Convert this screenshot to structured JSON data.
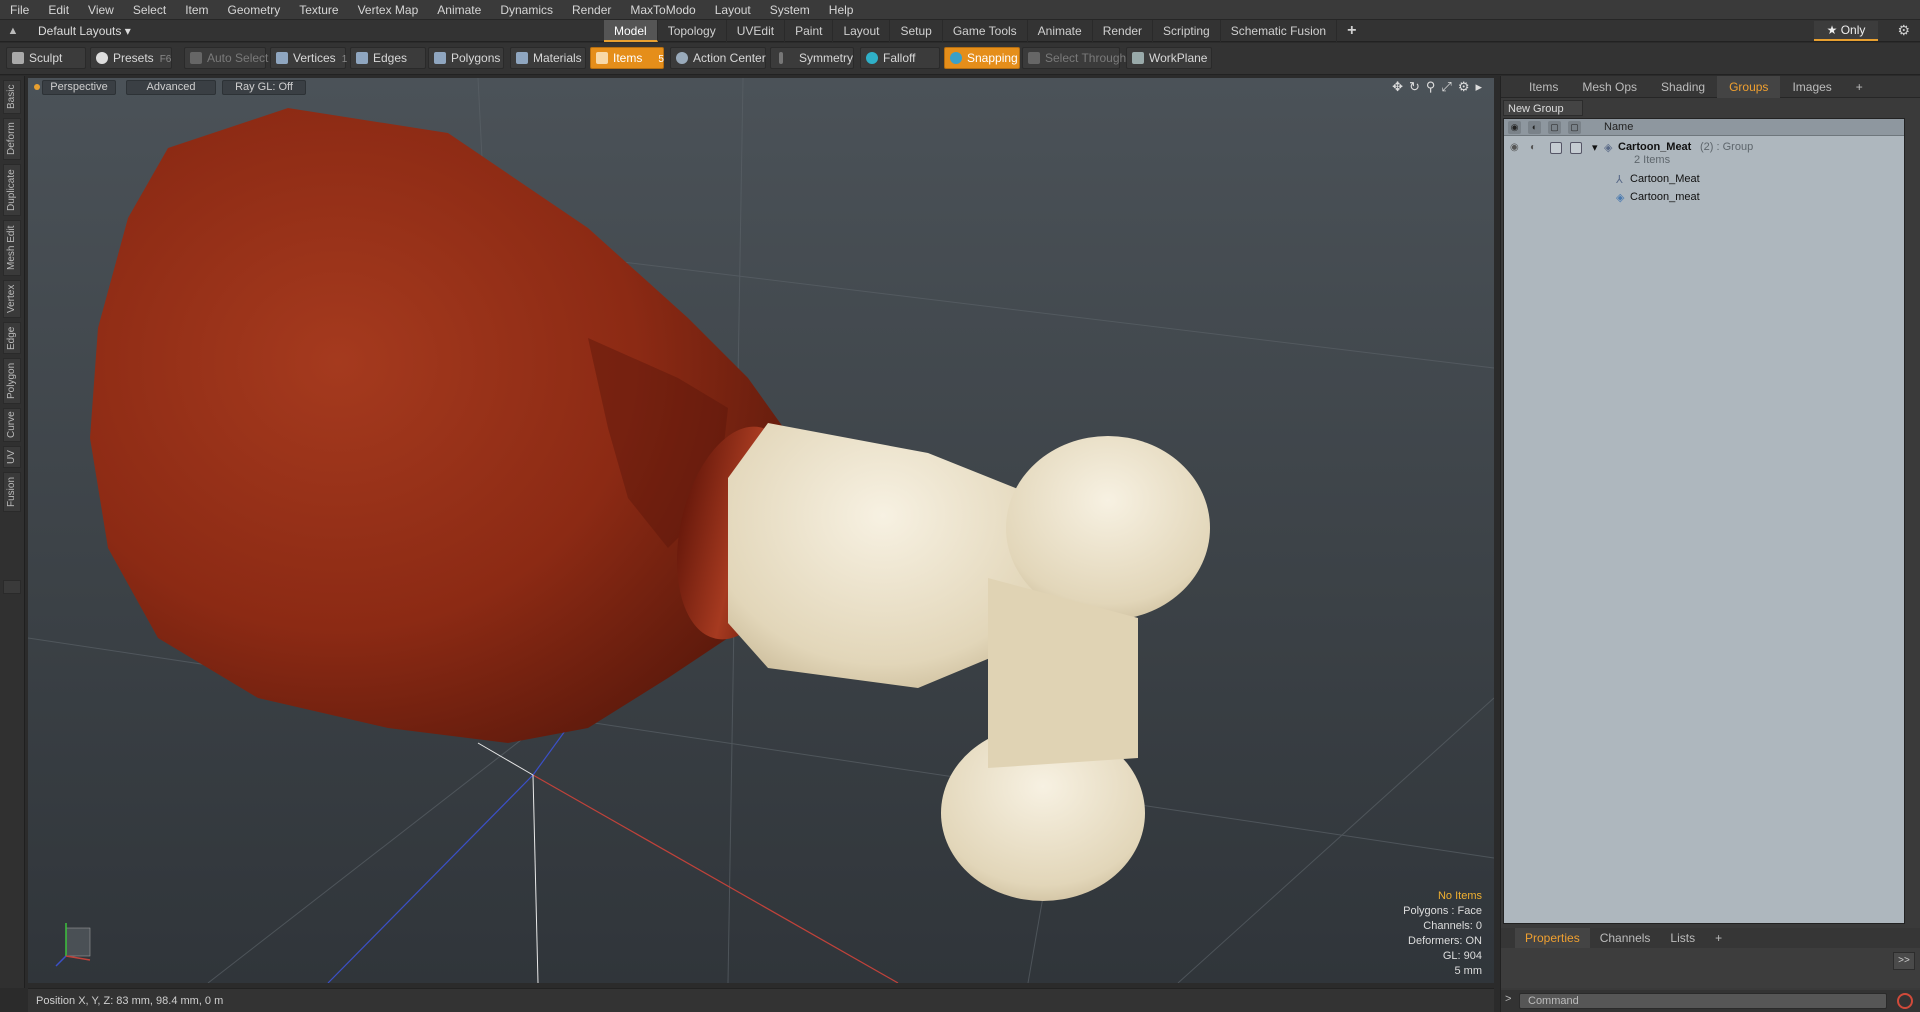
{
  "menubar": [
    "File",
    "Edit",
    "View",
    "Select",
    "Item",
    "Geometry",
    "Texture",
    "Vertex Map",
    "Animate",
    "Dynamics",
    "Render",
    "MaxToModo",
    "Layout",
    "System",
    "Help"
  ],
  "layout_dropdown": "Default Layouts ▾",
  "mode_tabs": [
    "Model",
    "Topology",
    "UVEdit",
    "Paint",
    "Layout",
    "Setup",
    "Game Tools",
    "Animate",
    "Render",
    "Scripting",
    "Schematic Fusion",
    "+"
  ],
  "active_mode_tab": "Model",
  "only_label": "★  Only",
  "toolbar": {
    "sculpt": "Sculpt",
    "presets": "Presets",
    "presets_key": "F6",
    "auto_select": "Auto Select",
    "vertices": "Vertices",
    "vertices_key": "1",
    "edges": "Edges",
    "edges_key": "2",
    "polygons": "Polygons",
    "materials": "Materials",
    "items": "Items",
    "items_key": "5",
    "action_center": "Action Center",
    "symmetry": "Symmetry",
    "falloff": "Falloff",
    "snapping": "Snapping",
    "select_through": "Select Through",
    "workplane": "WorkPlane"
  },
  "left_tabs": [
    "Basic",
    "Deform",
    "Duplicate",
    "Mesh Edit",
    "Vertex",
    "Edge",
    "Polygon",
    "Curve",
    "UV",
    "Fusion"
  ],
  "viewport": {
    "view": "Perspective",
    "shading": "Advanced",
    "raygl": "Ray GL: Off",
    "info": {
      "no_items": "No Items",
      "polygons": "Polygons : Face",
      "channels": "Channels: 0",
      "deformers": "Deformers: ON",
      "gl": "GL: 904",
      "scale": "5 mm"
    }
  },
  "status": "Position X, Y, Z:  83 mm, 98.4 mm, 0 m",
  "right_panel": {
    "tabs": [
      "Items",
      "Mesh Ops",
      "Shading",
      "Groups",
      "Images",
      "+"
    ],
    "active_tab": "Groups",
    "new_group": "New Group",
    "column_name": "Name",
    "group": {
      "name": "Cartoon_Meat",
      "suffix": "(2) : Group",
      "count": "2 Items"
    },
    "children": [
      "Cartoon_Meat",
      "Cartoon_meat"
    ],
    "bottom_tabs": [
      "Properties",
      "Channels",
      "Lists",
      "+"
    ],
    "active_bottom_tab": "Properties",
    "expand": ">>",
    "command_placeholder": "Command"
  },
  "colors": {
    "accent": "#e58e1a",
    "meat": "#8c2a14",
    "bone": "#e9dfc7"
  }
}
